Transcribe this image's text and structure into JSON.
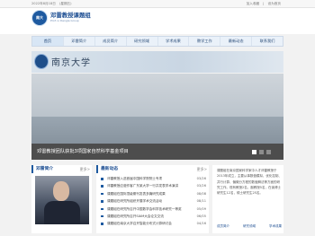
{
  "topbar": {
    "date_text": "2022年8月18日",
    "weather_text": "(星期五)",
    "right_links": [
      "加入收藏",
      "|",
      "设为首页"
    ]
  },
  "header": {
    "logo_cn": "邓雷教授课题组",
    "logo_en": "Prof. Li Dengle Group",
    "seal_text": "南大"
  },
  "nav": {
    "items": [
      "首页",
      "邓雷简介",
      "成员简介",
      "研究领域",
      "学术成果",
      "教学工作",
      "最新动态",
      "联系我们"
    ],
    "active_index": 0
  },
  "banner": {
    "calligraphy": "南京大学"
  },
  "slider": {
    "caption": "邓雷教授团队获批3项国家自然科学基金项目",
    "dot_count": 3,
    "active_dot": 0
  },
  "intro": {
    "title": "邓雷简介",
    "more": "更多>"
  },
  "news": {
    "title": "最新动态",
    "more": "更多>",
    "items": [
      {
        "title": "邓雷教授入选首届中国科学院院士专项",
        "date": "03/26"
      },
      {
        "title": "邓雷教授应邀作客广东某大学一行并发表学术演讲",
        "date": "03/26"
      },
      {
        "title": "课题组在国际顶级期刊发表多篇研究成果",
        "date": "08/08"
      },
      {
        "title": "课题组在研究所组织开展学术交流活动",
        "date": "08/11"
      },
      {
        "title": "课题组在研究所召开中国数学会科学技术研究一等奖",
        "date": "05/09"
      },
      {
        "title": "课题组在研究所召开SIAM大会论文交流",
        "date": "06/05"
      },
      {
        "title": "课题组在南京大学召开智能分布式计算研讨会",
        "date": "04/16"
      }
    ]
  },
  "side": {
    "text": "课题组在南京国家科学家中人才邓雷教授于2013年成立，主要从事数值模拟、优化控制、并行计算、偏微分方程的数值解法等方面的研究工作。现有教授2名，副教授5名，在读博士研究生12名，硕士研究生25名。",
    "links": [
      "成员简介",
      "研究领域",
      "学术成果"
    ]
  },
  "colors": {
    "accent": "#1e5aa0",
    "caption_bg": "#4d4d4d",
    "nav_bg": "#eaf1f9"
  }
}
